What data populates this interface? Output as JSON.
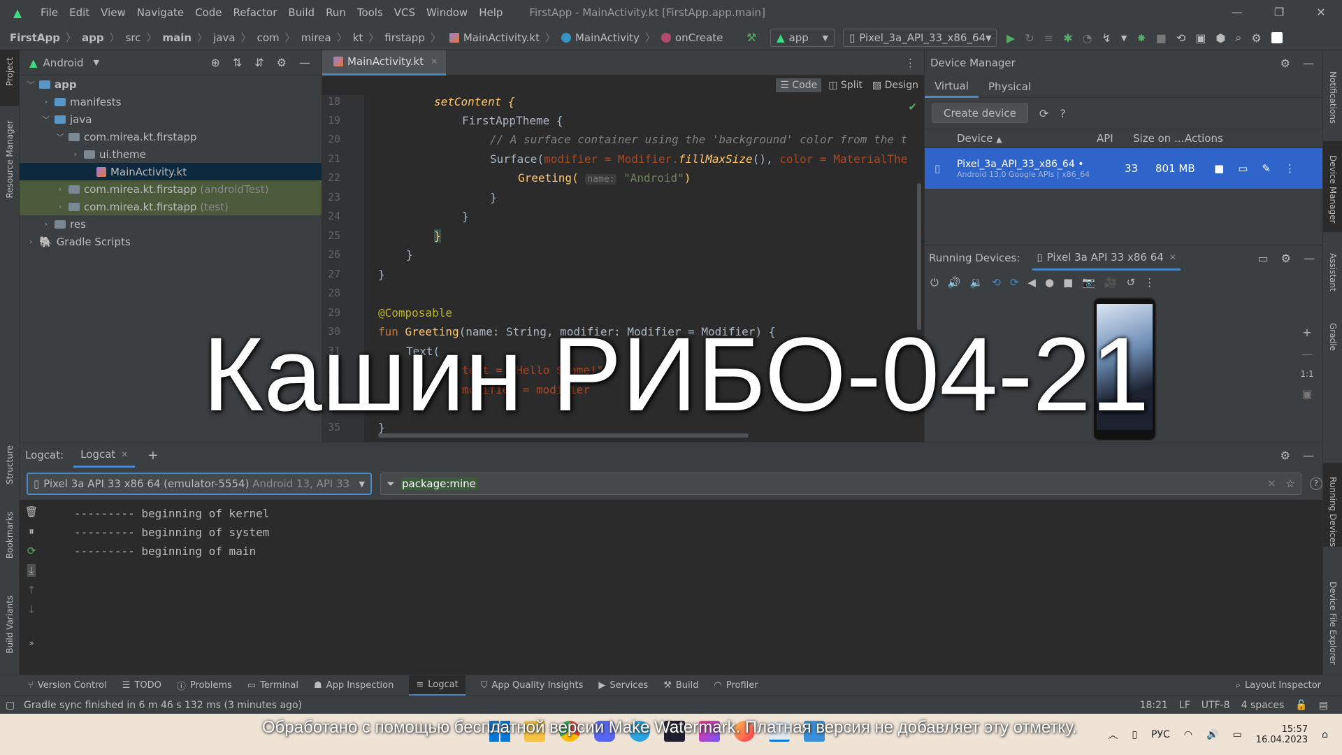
{
  "menu": {
    "items": [
      "File",
      "Edit",
      "View",
      "Navigate",
      "Code",
      "Refactor",
      "Build",
      "Run",
      "Tools",
      "VCS",
      "Window",
      "Help"
    ],
    "window_title": "FirstApp - MainActivity.kt [FirstApp.app.main]"
  },
  "breadcrumbs": [
    "FirstApp",
    "app",
    "src",
    "main",
    "java",
    "com",
    "mirea",
    "kt",
    "firstapp",
    "MainActivity.kt",
    "MainActivity",
    "onCreate"
  ],
  "toolbar": {
    "run_config": "app",
    "device": "Pixel_3a_API_33_x86_64"
  },
  "project": {
    "view_mode": "Android",
    "tree": [
      {
        "label": "app",
        "depth": 0,
        "expanded": true,
        "bold": true
      },
      {
        "label": "manifests",
        "depth": 1,
        "expanded": false
      },
      {
        "label": "java",
        "depth": 1,
        "expanded": true
      },
      {
        "label": "com.mirea.kt.firstapp",
        "depth": 2,
        "expanded": true
      },
      {
        "label": "ui.theme",
        "depth": 3,
        "expanded": false
      },
      {
        "label": "MainActivity.kt",
        "depth": 4,
        "selected": true
      },
      {
        "label": "com.mirea.kt.firstapp",
        "suffix": "(androidTest)",
        "depth": 2,
        "expanded": false
      },
      {
        "label": "com.mirea.kt.firstapp",
        "suffix": "(test)",
        "depth": 2,
        "expanded": false
      },
      {
        "label": "res",
        "depth": 1,
        "expanded": false
      },
      {
        "label": "Gradle Scripts",
        "depth": 0,
        "expanded": false
      }
    ]
  },
  "editor": {
    "tab": "MainActivity.kt",
    "modes": [
      "Code",
      "Split",
      "Design"
    ],
    "line_numbers": [
      "18",
      "19",
      "20",
      "21",
      "22",
      "23",
      "24",
      "25",
      "26",
      "27",
      "28",
      "29",
      "30",
      "31",
      "32",
      "33",
      "35"
    ],
    "lines": {
      "l18": "setContent {",
      "l19": "FirstAppTheme {",
      "l20": "// A surface container using the 'background' color from the t",
      "l21a": "Surface(",
      "l21b": "modifier = Modifier.",
      "l21c": "fillMaxSize",
      "l21d": "(), ",
      "l21e": "color = MaterialThe",
      "l22a": "Greeting(",
      "l22hint": "name:",
      "l22str": "\"Android\"",
      "l22b": ")",
      "l23": "}",
      "l24": "}",
      "l25": "}",
      "l26": "}",
      "l27": "}",
      "l29": "@Composable",
      "l30kw": "fun ",
      "l30fn": "Greeting",
      "l30rest": "(name: String, modifier: Modifier = Modifier) {",
      "l31": "Text(",
      "l32": "text = \"Hello $name!\",",
      "l33": "modifier = modifier",
      "l35": "}"
    }
  },
  "device_manager": {
    "title": "Device Manager",
    "tabs": [
      "Virtual",
      "Physical"
    ],
    "create_label": "Create device",
    "help": "?",
    "columns": [
      "Device",
      "API",
      "Size on ...",
      "Actions"
    ],
    "device": {
      "name": "Pixel_3a_API_33_x86_64",
      "sub": "Android 13.0 Google APIs | x86_64",
      "api": "33",
      "size": "801 MB"
    }
  },
  "running_devices": {
    "label": "Running Devices:",
    "tab": "Pixel 3a API 33 x86 64",
    "zoom_ratio": "1:1"
  },
  "logcat": {
    "label": "Logcat:",
    "tab": "Logcat",
    "device_combo": "Pixel 3a API 33 x86 64 (emulator-5554)",
    "device_combo_suffix": "Android 13, API 33",
    "filter": "package:mine",
    "lines": [
      "--------- beginning of kernel",
      "--------- beginning of system",
      "--------- beginning of main"
    ]
  },
  "bottom_tabs": [
    "Version Control",
    "TODO",
    "Problems",
    "Terminal",
    "App Inspection",
    "Logcat",
    "App Quality Insights",
    "Services",
    "Build",
    "Profiler"
  ],
  "layout_inspector": "Layout Inspector",
  "left_strip": [
    "Project",
    "Resource Manager",
    "Structure",
    "Bookmarks",
    "Build Variants"
  ],
  "right_strip": [
    "Notifications",
    "Device Manager",
    "Assistant",
    "Gradle",
    "Running Devices",
    "Device File Explorer"
  ],
  "status": {
    "message": "Gradle sync finished in 6 m 46 s 132 ms (3 minutes ago)",
    "position": "18:21",
    "line_sep": "LF",
    "encoding": "UTF-8",
    "indent": "4 spaces"
  },
  "overlay_text": "Кашин РИБО-04-21",
  "watermark_text": "Обработано с помощью бесплатной версии Make Watermark. Платная версия не добавляет эту отметку.",
  "taskbar": {
    "lang": "РУС",
    "time": "15:57",
    "date": "16.04.2023"
  },
  "colors": {
    "bg_dark": "#2b2b2b",
    "panel": "#3c3f41",
    "selection": "#2f65ca",
    "accent": "#4a88c7"
  }
}
